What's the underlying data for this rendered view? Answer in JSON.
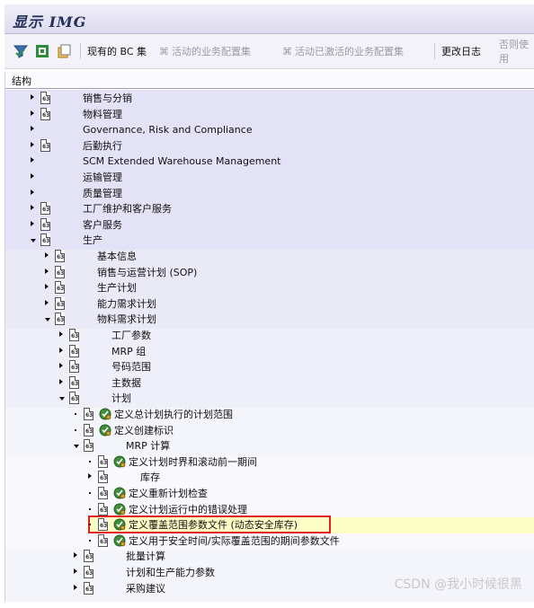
{
  "window": {
    "title": "显示 IMG"
  },
  "toolbar": {
    "bc_set": "现有的 BC 集",
    "active_business_config": "活动的业务配置集",
    "activated_business_config": "活动已激活的业务配置集",
    "change_log": "更改日志",
    "otherwise": "否则使用"
  },
  "structure": {
    "header": "结构",
    "rows": [
      "销售与分销",
      "物料管理",
      "Governance, Risk and Compliance",
      "后勤执行",
      "SCM Extended Warehouse Management",
      "运输管理",
      "质量管理",
      "工厂维护和客户服务",
      "客户服务",
      "生产",
      "基本信息",
      "销售与运营计划 (SOP)",
      "生产计划",
      "能力需求计划",
      "物料需求计划",
      "工厂参数",
      "MRP 组",
      "号码范围",
      "主数据",
      "计划",
      "定义总计划执行的计划范围",
      "定义创建标识",
      "MRP 计算",
      "定义计划时界和滚动前一期间",
      "库存",
      "定义重新计划检查",
      "定义计划运行中的错误处理",
      "定义覆盖范围参数文件 (动态安全库存)",
      "定义用于安全时间/实际覆盖范围的期间参数文件",
      "批量计算",
      "计划和生产能力参数",
      "采购建议"
    ]
  },
  "watermark": "CSDN @我小时候很黑"
}
